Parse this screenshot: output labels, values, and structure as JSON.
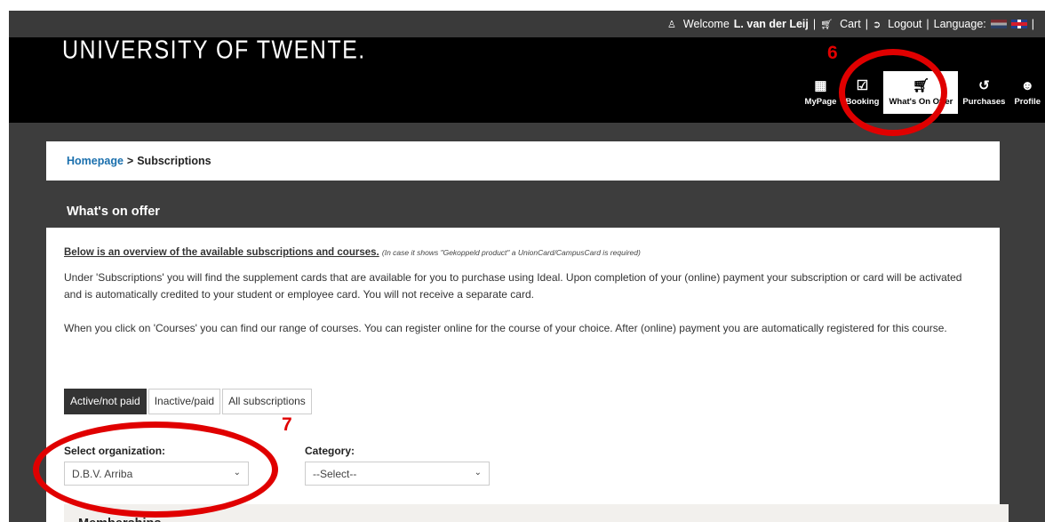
{
  "topbar": {
    "welcome_prefix": "Welcome",
    "user_name": "L. van der Leij",
    "cart": "Cart",
    "logout": "Logout",
    "language": "Language:",
    "sep": "|"
  },
  "header": {
    "logo_text": "UNIVERSITY OF TWENTE.",
    "nav": [
      {
        "label": "MyPage",
        "icon": "grid-icon"
      },
      {
        "label": "Booking",
        "icon": "calendar-check-icon"
      },
      {
        "label": "What's On Offer",
        "icon": "cart-icon"
      },
      {
        "label": "Purchases",
        "icon": "history-icon"
      },
      {
        "label": "Profile",
        "icon": "user-circle-icon"
      }
    ]
  },
  "annotations": {
    "six": "6",
    "seven": "7",
    "color": "#e00000"
  },
  "breadcrumb": {
    "home": "Homepage",
    "separator": ">",
    "current": "Subscriptions"
  },
  "section": {
    "title": "What's on offer"
  },
  "content": {
    "intro_bold": "Below is an overview of the available subscriptions and courses.",
    "intro_note": "(In case it shows \"Gekoppeld product\" a UnionCard/CampusCard is required)",
    "para1": "Under 'Subscriptions' you will find the supplement cards that are available for you to purchase using Ideal. Upon completion of your (online) payment your subscription or card will be activated and is automatically credited to your student or employee card. You will not receive a separate card.",
    "para2": "When you click on 'Courses' you can find our range of courses. You can register online for the course of your choice. After (online) payment you are automatically registered for this course."
  },
  "tabs": [
    {
      "label": "Active/not paid",
      "active": true
    },
    {
      "label": "Inactive/paid",
      "active": false
    },
    {
      "label": "All subscriptions",
      "active": false
    }
  ],
  "filters": {
    "organization_label": "Select organization:",
    "organization_value": "D.B.V. Arriba",
    "category_label": "Category:",
    "category_value": "--Select--"
  },
  "memberships": {
    "title": "Memberships"
  }
}
